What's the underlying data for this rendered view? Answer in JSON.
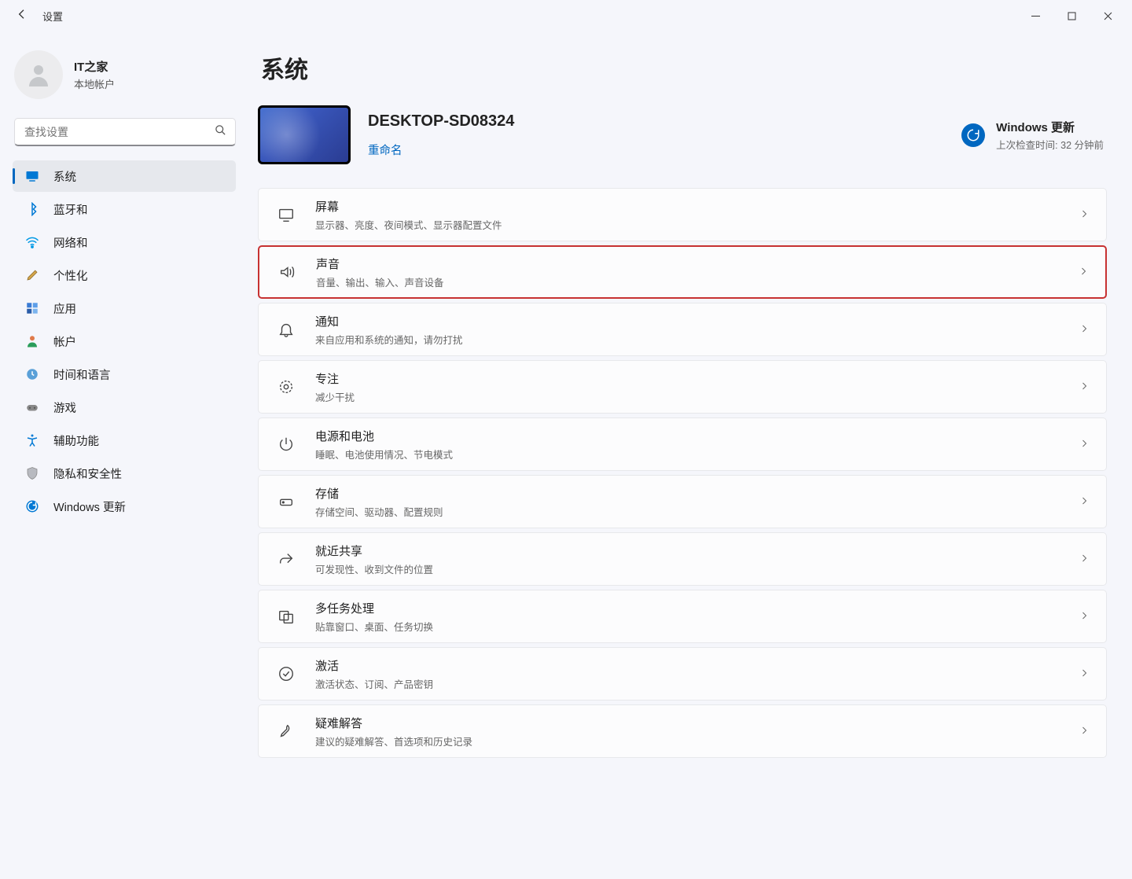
{
  "window": {
    "title": "设置"
  },
  "user": {
    "name": "IT之家",
    "sub": "本地帐户"
  },
  "search": {
    "placeholder": "查找设置"
  },
  "sidebar": {
    "items": [
      {
        "label": "系统",
        "selected": true,
        "icon": "display"
      },
      {
        "label": "蓝牙和",
        "icon": "bluetooth"
      },
      {
        "label": "网络和",
        "icon": "wifi"
      },
      {
        "label": "个性化",
        "icon": "brush"
      },
      {
        "label": "应用",
        "icon": "apps"
      },
      {
        "label": "帐户",
        "icon": "person"
      },
      {
        "label": "时间和语言",
        "icon": "clock"
      },
      {
        "label": "游戏",
        "icon": "gamepad"
      },
      {
        "label": "辅助功能",
        "icon": "accessibility"
      },
      {
        "label": "隐私和安全性",
        "icon": "shield"
      },
      {
        "label": "Windows 更新",
        "icon": "update"
      }
    ]
  },
  "page": {
    "title": "系统",
    "device_name": "DESKTOP-SD08324",
    "rename": "重命名",
    "update": {
      "title": "Windows 更新",
      "sub": "上次检查时间: 32 分钟前"
    }
  },
  "cards": [
    {
      "icon": "display",
      "title": "屏幕",
      "sub": "显示器、亮度、夜间模式、显示器配置文件",
      "highlighted": false
    },
    {
      "icon": "sound",
      "title": "声音",
      "sub": "音量、输出、输入、声音设备",
      "highlighted": true
    },
    {
      "icon": "bell",
      "title": "通知",
      "sub": "来自应用和系统的通知，请勿打扰",
      "highlighted": false
    },
    {
      "icon": "focus",
      "title": "专注",
      "sub": "减少干扰",
      "highlighted": false
    },
    {
      "icon": "power",
      "title": "电源和电池",
      "sub": "睡眠、电池使用情况、节电模式",
      "highlighted": false
    },
    {
      "icon": "storage",
      "title": "存储",
      "sub": "存储空间、驱动器、配置规则",
      "highlighted": false
    },
    {
      "icon": "share",
      "title": "就近共享",
      "sub": "可发现性、收到文件的位置",
      "highlighted": false
    },
    {
      "icon": "multitask",
      "title": "多任务处理",
      "sub": "贴靠窗口、桌面、任务切换",
      "highlighted": false
    },
    {
      "icon": "activate",
      "title": "激活",
      "sub": "激活状态、订阅、产品密钥",
      "highlighted": false
    },
    {
      "icon": "troubleshoot",
      "title": "疑难解答",
      "sub": "建议的疑难解答、首选项和历史记录",
      "highlighted": false
    }
  ]
}
